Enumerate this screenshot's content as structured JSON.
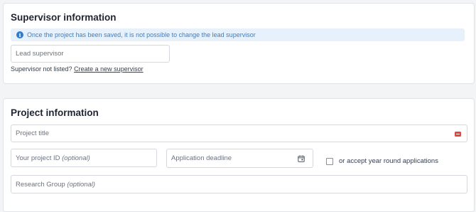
{
  "supervisor_section": {
    "title": "Supervisor information",
    "info_message": "Once the project has been saved, it is not possible to change the lead supervisor",
    "lead_supervisor_placeholder": "Lead supervisor",
    "not_listed_text": "Supervisor not listed?",
    "create_link": "Create a new supervisor"
  },
  "project_section": {
    "title": "Project information",
    "project_title_placeholder": "Project title",
    "project_id_placeholder": "Your project ID",
    "project_id_optional": "(optional)",
    "application_deadline_placeholder": "Application deadline",
    "year_round_label": "or accept year round applications",
    "research_group_placeholder": "Research Group",
    "research_group_optional": "(optional)"
  },
  "colors": {
    "info_bg": "#e7f1fb",
    "info_text": "#3b7fc6",
    "required": "#e0483e"
  }
}
